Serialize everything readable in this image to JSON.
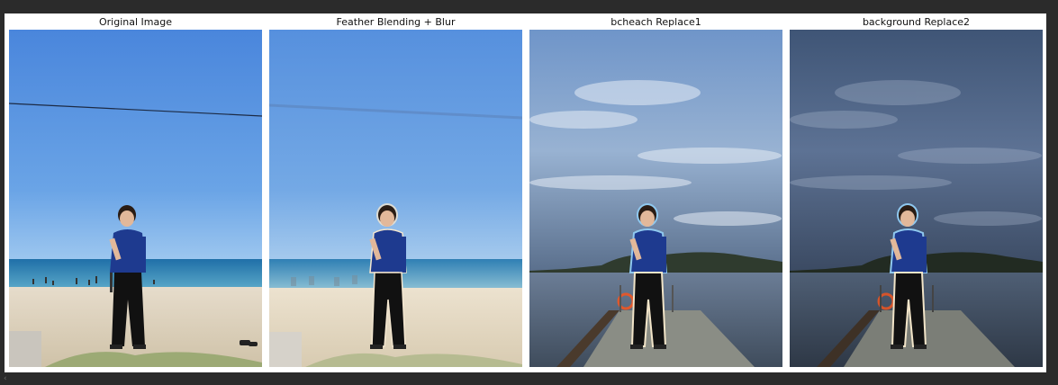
{
  "figure": {
    "panels": [
      {
        "title": "Original Image",
        "icon": "photo-original"
      },
      {
        "title": "Feather Blending + Blur",
        "icon": "photo-blurred-background"
      },
      {
        "title": "bcheach Replace1",
        "icon": "photo-replaced-background-1"
      },
      {
        "title": "background Replace2",
        "icon": "photo-replaced-background-2"
      }
    ]
  },
  "colors": {
    "page_background": "#2b2b2b",
    "figure_background": "#ffffff",
    "sky_blue": "#4f8ee0",
    "shirt_navy": "#1e3a8f",
    "cloudy_sky": "#7f9cc0"
  },
  "scroll": {
    "left_arrow": "‹"
  }
}
